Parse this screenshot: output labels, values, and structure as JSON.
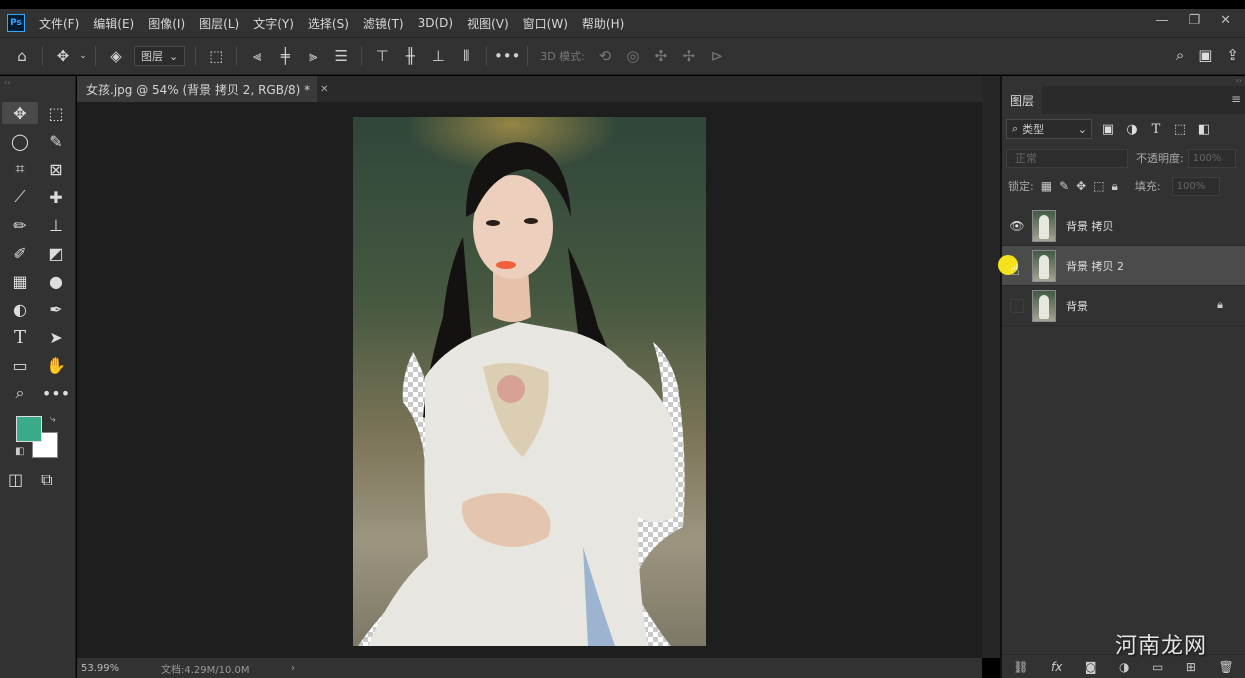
{
  "app": {
    "logo": "Ps"
  },
  "menu": [
    "文件(F)",
    "编辑(E)",
    "图像(I)",
    "图层(L)",
    "文字(Y)",
    "选择(S)",
    "滤镜(T)",
    "3D(D)",
    "视图(V)",
    "窗口(W)",
    "帮助(H)"
  ],
  "window_controls": [
    "—",
    "❐",
    "✕"
  ],
  "options_bar": {
    "auto_select_target": "图层",
    "mode_3d_label": "3D 模式:"
  },
  "colors": {
    "foreground": "#3aab8a",
    "background": "#ffffff",
    "selection_cursor": "#f4e21c"
  },
  "document": {
    "tab_title": "女孩.jpg @ 54% (背景 拷贝 2, RGB/8) *",
    "zoom": "53.99%",
    "doc_size": "文档:4.29M/10.0M"
  },
  "layers_panel": {
    "tab_label": "图层",
    "filter_kind": "类型",
    "blend_mode": "正常",
    "opacity_label": "不透明度:",
    "opacity_value": "100%",
    "lock_label": "锁定:",
    "fill_label": "填充:",
    "fill_value": "100%",
    "layers": [
      {
        "name": "背景 拷贝",
        "visible": true,
        "selected": false,
        "locked": false
      },
      {
        "name": "背景 拷贝 2",
        "visible": true,
        "selected": true,
        "locked": false
      },
      {
        "name": "背景",
        "visible": false,
        "selected": false,
        "locked": true
      }
    ]
  },
  "watermark": "河南龙网"
}
